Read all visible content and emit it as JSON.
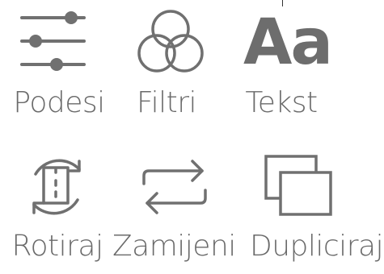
{
  "tools": {
    "adjust": {
      "label": "Podesi",
      "icon": "sliders-icon"
    },
    "filters": {
      "label": "Filtri",
      "icon": "overlapping-circles-icon"
    },
    "text": {
      "label": "Tekst",
      "icon": "text-aa-icon",
      "glyph": "Aa"
    },
    "rotate": {
      "label": "Rotiraj",
      "icon": "rotate-icon"
    },
    "replace": {
      "label": "Zamijeni",
      "icon": "swap-arrows-icon"
    },
    "duplicate": {
      "label": "Dupliciraj",
      "icon": "duplicate-icon"
    }
  },
  "colors": {
    "icon": "#707070",
    "label": "#6a6a6a"
  }
}
